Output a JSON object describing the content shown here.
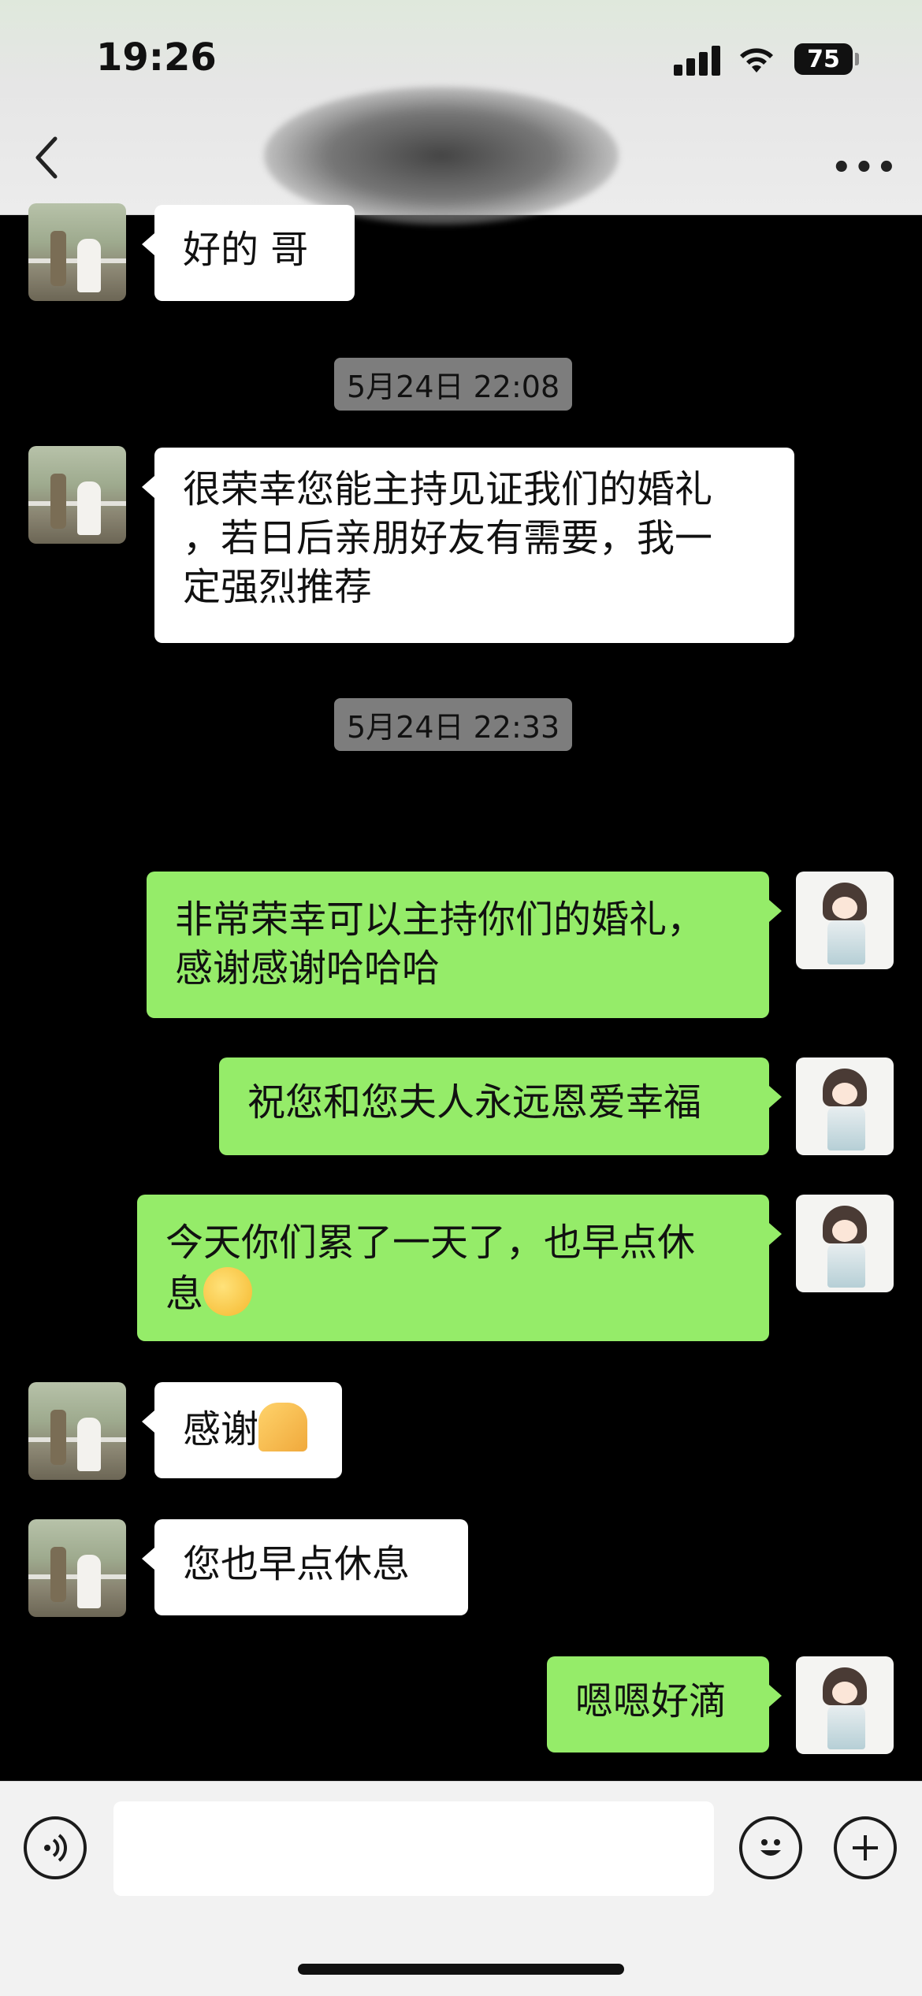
{
  "status_bar": {
    "time": "19:26",
    "battery": "75"
  },
  "nav": {
    "back_icon": "chevron-left-icon",
    "more_icon": "more-dots-icon"
  },
  "messages": [
    {
      "side": "left",
      "text": "好的 哥"
    },
    {
      "type": "timestamp",
      "text": "5月24日 22:08"
    },
    {
      "side": "left",
      "lines": [
        "很荣幸您能主持见证我们的婚礼",
        "，若日后亲朋好友有需要，我一",
        "定强烈推荐"
      ]
    },
    {
      "type": "timestamp",
      "text": "5月24日 22:33"
    },
    {
      "side": "right",
      "lines": [
        "非常荣幸可以主持你们的婚礼，",
        "感谢感谢哈哈哈"
      ]
    },
    {
      "side": "right",
      "text": "祝您和您夫人永远恩爱幸福"
    },
    {
      "side": "right",
      "lines": [
        "今天你们累了一天了，也早点休",
        "息"
      ],
      "emoji": "thinking-face-emoji"
    },
    {
      "side": "left",
      "text": "感谢",
      "emoji": "pray-hands-emoji"
    },
    {
      "side": "left",
      "text": "您也早点休息"
    },
    {
      "side": "right",
      "text": "嗯嗯好滴"
    }
  ],
  "input_bar": {
    "voice_icon": "voice-icon",
    "emoji_icon": "smile-icon",
    "plus_icon": "plus-icon",
    "input_value": ""
  }
}
